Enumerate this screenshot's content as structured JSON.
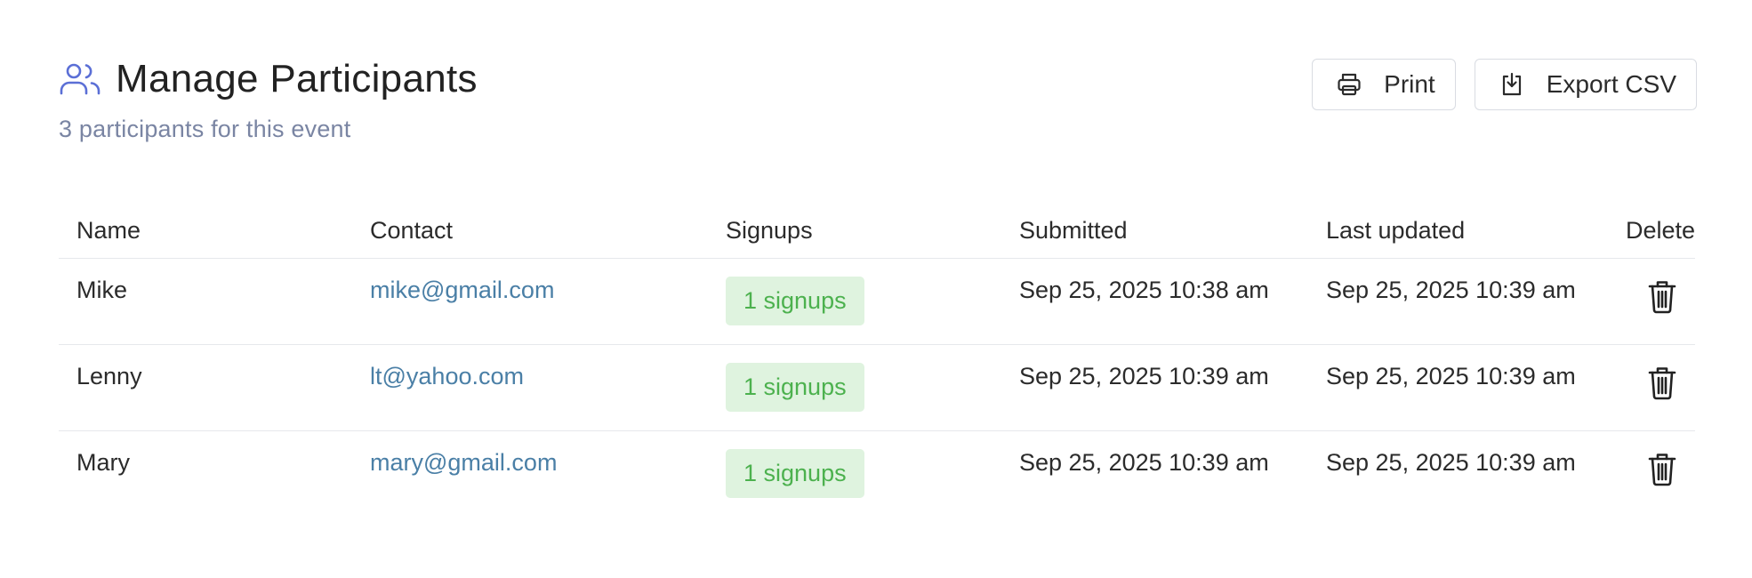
{
  "header": {
    "title": "Manage Participants",
    "subtitle": "3 participants for this event",
    "title_icon": "users-icon",
    "print_label": "Print",
    "print_icon": "printer-icon",
    "export_label": "Export CSV",
    "export_icon": "download-icon"
  },
  "table": {
    "columns": [
      "Name",
      "Contact",
      "Signups",
      "Submitted",
      "Last updated",
      "Delete"
    ],
    "rows": [
      {
        "name": "Mike",
        "contact": "mike@gmail.com",
        "signups": "1 signups",
        "submitted": "Sep 25, 2025 10:38 am",
        "updated": "Sep 25, 2025 10:39 am"
      },
      {
        "name": "Lenny",
        "contact": "lt@yahoo.com",
        "signups": "1 signups",
        "submitted": "Sep 25, 2025 10:39 am",
        "updated": "Sep 25, 2025 10:39 am"
      },
      {
        "name": "Mary",
        "contact": "mary@gmail.com",
        "signups": "1 signups",
        "submitted": "Sep 25, 2025 10:39 am",
        "updated": "Sep 25, 2025 10:39 am"
      }
    ],
    "delete_icon": "trash-icon"
  },
  "colors": {
    "accent": "#5b6fd6",
    "link": "#4a7fa6",
    "subtitle": "#7a85a3",
    "badge_bg": "#dff3df",
    "badge_text": "#4cb14e"
  }
}
